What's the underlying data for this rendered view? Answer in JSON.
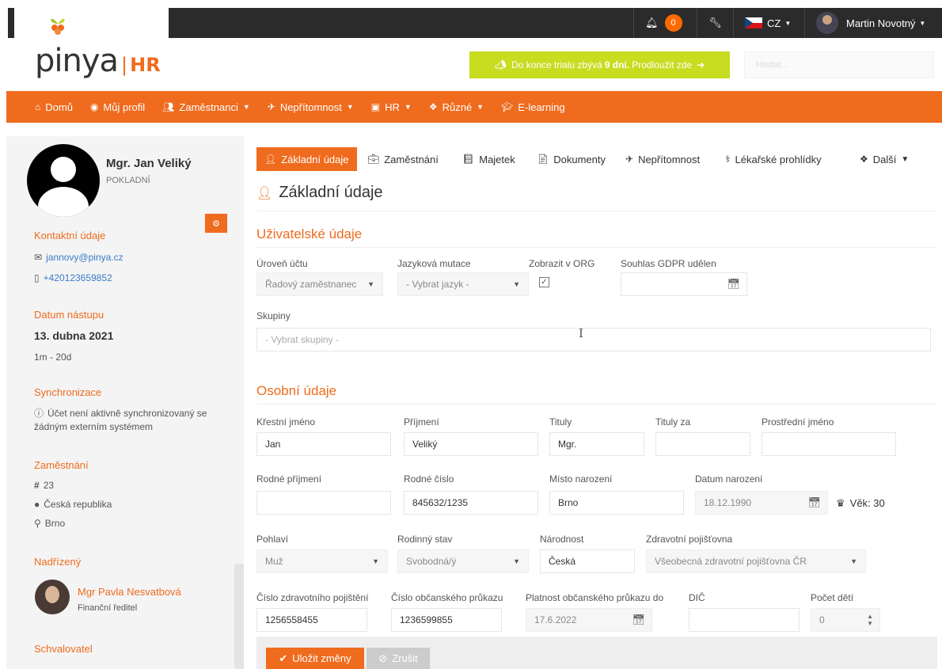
{
  "topbar": {
    "notif_count": "0",
    "language": "CZ",
    "user_name": "Martin Novotný"
  },
  "logo": {
    "brand": "pinya",
    "sep": "|",
    "suffix": "HR"
  },
  "trial": {
    "prefix": "Do konce trialu zbývá",
    "days": "9 dní.",
    "extend": "Prodloužit zde"
  },
  "search": {
    "placeholder": "Hledat..."
  },
  "nav": {
    "home": "Domů",
    "profile": "Můj profil",
    "employees": "Zaměstnanci",
    "absence": "Nepřítomnost",
    "hr": "HR",
    "misc": "Různé",
    "elearning": "E-learning"
  },
  "profile": {
    "name": "Mgr. Jan Veliký",
    "role": "POKLADNÍ",
    "contact_title": "Kontaktní údaje",
    "email": "jannovy@pinya.cz",
    "phone": "+420123659852",
    "start_title": "Datum nástupu",
    "start_date": "13. dubna 2021",
    "tenure": "1m - 20d",
    "sync_title": "Synchronizace",
    "sync_text": "Účet není aktivně synchronizovaný se žádným externím systémem",
    "employment_title": "Zaměstnání",
    "emp_number": "23",
    "country": "Česká republika",
    "city": "Brno",
    "supervisor_title": "Nadřízený",
    "supervisor_name": "Mgr Pavla Nesvatbová",
    "supervisor_role": "Finanční ředitel",
    "approver_title": "Schvalovatel"
  },
  "tabs": {
    "basic": "Základní údaje",
    "employment": "Zaměstnání",
    "property": "Majetek",
    "documents": "Dokumenty",
    "absence": "Nepřítomnost",
    "medical": "Lékařské prohlídky",
    "more": "Další"
  },
  "page_title": "Základní údaje",
  "user_section": {
    "title": "Uživatelské údaje",
    "account_level_label": "Úroveň účtu",
    "account_level_value": "Řadový zaměstnanec",
    "language_label": "Jazyková mutace",
    "language_value": "- Vybrat jazyk -",
    "show_org_label": "Zobrazit v ORG",
    "gdpr_label": "Souhlas GDPR udělen",
    "groups_label": "Skupiny",
    "groups_placeholder": "- Vybrat skupiny -"
  },
  "personal_section": {
    "title": "Osobní údaje",
    "first_name_label": "Křestní jméno",
    "first_name": "Jan",
    "last_name_label": "Příjmení",
    "last_name": "Veliký",
    "titles_label": "Tituly",
    "titles": "Mgr.",
    "titles_after_label": "Tituly za",
    "middle_name_label": "Prostřední jméno",
    "birth_surname_label": "Rodné příjmení",
    "birth_number_label": "Rodné číslo",
    "birth_number": "845632/1235",
    "birth_place_label": "Místo narození",
    "birth_place": "Brno",
    "birth_date_label": "Datum narození",
    "birth_date": "18.12.1990",
    "age": "Věk: 30",
    "gender_label": "Pohlaví",
    "gender": "Muž",
    "marital_label": "Rodinný stav",
    "marital": "Svobodná/ý",
    "nationality_label": "Národnost",
    "nationality": "Česká",
    "insurer_label": "Zdravotní pojišťovna",
    "insurer": "Všeobecná zdravotní pojišťovna ČR",
    "insurance_no_label": "Číslo zdravotního pojištění",
    "insurance_no": "1256558455",
    "id_no_label": "Číslo občanského průkazu",
    "id_no": "1236599855",
    "id_valid_label": "Platnost občanského průkazu do",
    "id_valid": "17.6.2022",
    "tax_label": "DIČ",
    "children_label": "Počet dětí",
    "children": "0"
  },
  "actions": {
    "save": "Uložit změny",
    "cancel": "Zrušit"
  }
}
